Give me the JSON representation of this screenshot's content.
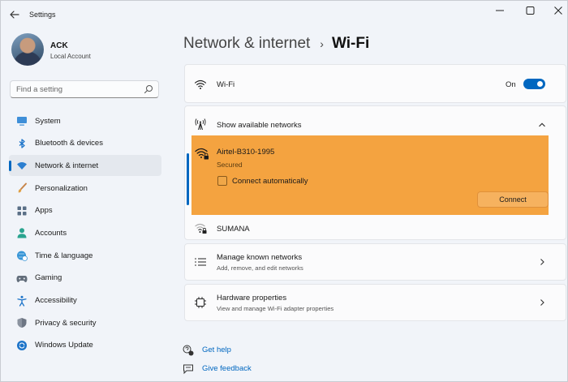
{
  "window": {
    "title": "Settings"
  },
  "user": {
    "name": "ACK",
    "account_type": "Local Account"
  },
  "search": {
    "placeholder": "Find a setting"
  },
  "sidebar": {
    "items": [
      {
        "label": "System",
        "icon": "monitor-icon"
      },
      {
        "label": "Bluetooth & devices",
        "icon": "bluetooth-icon"
      },
      {
        "label": "Network & internet",
        "icon": "wifi-icon",
        "active": true
      },
      {
        "label": "Personalization",
        "icon": "brush-icon"
      },
      {
        "label": "Apps",
        "icon": "apps-icon"
      },
      {
        "label": "Accounts",
        "icon": "person-icon"
      },
      {
        "label": "Time & language",
        "icon": "globe-clock-icon"
      },
      {
        "label": "Gaming",
        "icon": "gamepad-icon"
      },
      {
        "label": "Accessibility",
        "icon": "accessibility-icon"
      },
      {
        "label": "Privacy & security",
        "icon": "shield-icon"
      },
      {
        "label": "Windows Update",
        "icon": "update-icon"
      }
    ]
  },
  "breadcrumb": {
    "parent": "Network & internet",
    "separator": "›",
    "current": "Wi-Fi"
  },
  "wifi_card": {
    "title": "Wi-Fi",
    "toggle_label": "On",
    "toggle_on": true
  },
  "networks_card": {
    "title": "Show available networks",
    "networks": [
      {
        "ssid": "Airtel-B310-1995",
        "status": "Secured",
        "connect_auto_label": "Connect automatically",
        "connect_auto_checked": false,
        "connect_label": "Connect",
        "highlight_color": "#f4a340"
      },
      {
        "ssid": "SUMANA"
      }
    ]
  },
  "known_card": {
    "title": "Manage known networks",
    "subtitle": "Add, remove, and edit networks"
  },
  "hardware_card": {
    "title": "Hardware properties",
    "subtitle": "View and manage Wi-Fi adapter properties"
  },
  "links": {
    "help": "Get help",
    "feedback": "Give feedback"
  },
  "colors": {
    "accent": "#0067c0",
    "background": "#f1f4f9",
    "card": "#fbfbfc"
  }
}
